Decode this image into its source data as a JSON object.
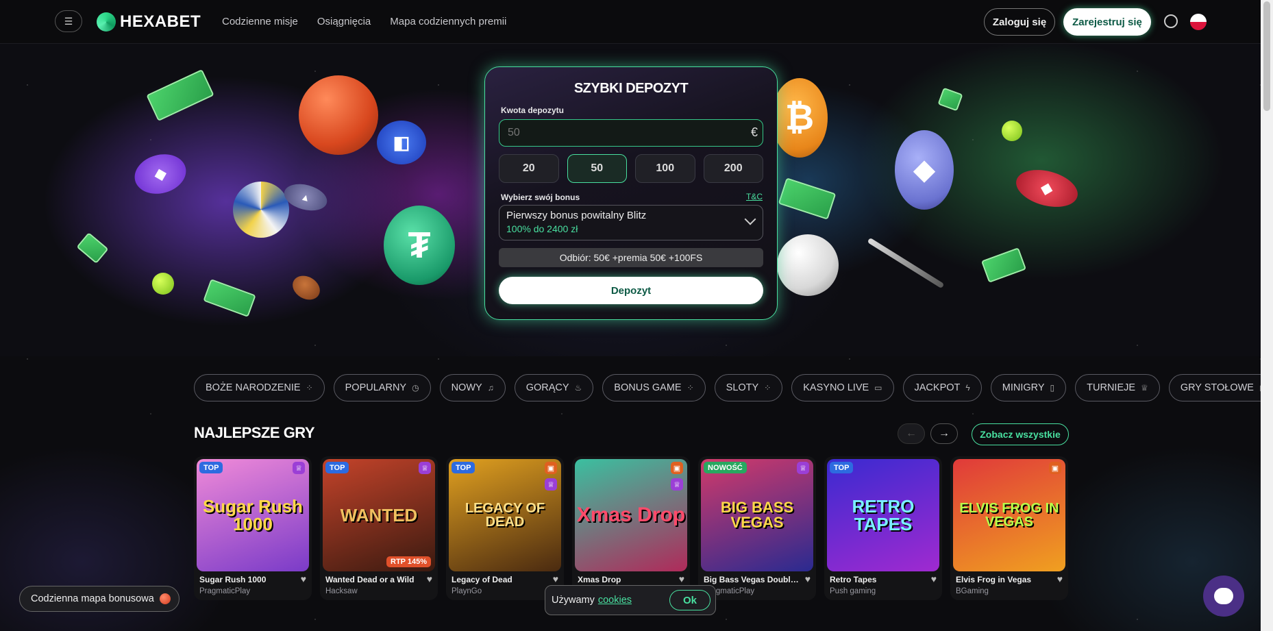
{
  "header": {
    "logo_text": "HEXABET",
    "nav": [
      "Codzienne misje",
      "Osiągnięcia",
      "Mapa codziennych premii"
    ],
    "login_label": "Zaloguj się",
    "register_label": "Zarejestruj się"
  },
  "deposit": {
    "title": "SZYBKI DEPOZYT",
    "amount_label": "Kwota depozytu",
    "amount_placeholder": "50",
    "currency": "€",
    "quick_amounts": [
      "20",
      "50",
      "100",
      "200"
    ],
    "selected_amount": "50",
    "bonus_label": "Wybierz swój bonus",
    "tc_label": "T&C",
    "bonus_name": "Pierwszy bonus powitalny Blitz",
    "bonus_value": "100% do 2400 zł",
    "summary": "Odbiór: 50€ +premia 50€ +100FS",
    "submit_label": "Depozyt"
  },
  "categories": [
    {
      "label": "BOŻE NARODZENIE",
      "icon": "grid-icon"
    },
    {
      "label": "POPULARNY",
      "icon": "clock-icon"
    },
    {
      "label": "NOWY",
      "icon": "bell-icon"
    },
    {
      "label": "GORĄCY",
      "icon": "flame-icon"
    },
    {
      "label": "BONUS GAME",
      "icon": "grid-icon"
    },
    {
      "label": "SLOTY",
      "icon": "grid-icon"
    },
    {
      "label": "KASYNO LIVE",
      "icon": "monitor-icon"
    },
    {
      "label": "JACKPOT",
      "icon": "bolt-icon"
    },
    {
      "label": "MINIGRY",
      "icon": "phone-icon"
    },
    {
      "label": "TURNIEJE",
      "icon": "trophy-icon"
    },
    {
      "label": "GRY STOŁOWE",
      "icon": "cards-icon"
    }
  ],
  "best_games": {
    "title": "NAJLEPSZE GRY",
    "see_all_label": "Zobacz wszystkie",
    "games": [
      {
        "name": "Sugar Rush 1000",
        "provider": "PragmaticPlay",
        "badge": "TOP",
        "thumb_text": "Sugar Rush 1000",
        "colors": [
          "#e86ad8",
          "#7a3bc8"
        ]
      },
      {
        "name": "Wanted Dead or a Wild",
        "provider": "Hacksaw",
        "badge": "TOP",
        "thumb_text": "WANTED",
        "rtp": "RTP 145%",
        "colors": [
          "#c4432a",
          "#3a1a10"
        ]
      },
      {
        "name": "Legacy of Dead",
        "provider": "PlaynGo",
        "badge": "TOP",
        "thumb_text": "LEGACY OF DEAD",
        "colors": [
          "#e0a020",
          "#4a2a10"
        ]
      },
      {
        "name": "Xmas Drop",
        "provider": "",
        "badge": "",
        "thumb_text": "Xmas Drop",
        "colors": [
          "#3ac0a0",
          "#b02a5a"
        ]
      },
      {
        "name": "Big Bass Vegas Double Down Deluxe",
        "provider": "PragmaticPlay",
        "badge": "NOWOŚĆ",
        "thumb_text": "BIG BASS VEGAS",
        "colors": [
          "#d23a6a",
          "#2a2a90"
        ]
      },
      {
        "name": "Retro Tapes",
        "provider": "Push gaming",
        "badge": "TOP",
        "thumb_text": "RETRO TAPES",
        "colors": [
          "#3a2ad0",
          "#a02ad0"
        ]
      },
      {
        "name": "Elvis Frog in Vegas",
        "provider": "BGaming",
        "badge": "",
        "thumb_text": "ELVIS FROG IN VEGAS",
        "colors": [
          "#e03a3a",
          "#f0a020"
        ]
      }
    ]
  },
  "daily_map_label": "Codzienna mapa bonusowa",
  "cookie": {
    "text": "Używamy",
    "link": "cookies",
    "ok_label": "Ok"
  }
}
